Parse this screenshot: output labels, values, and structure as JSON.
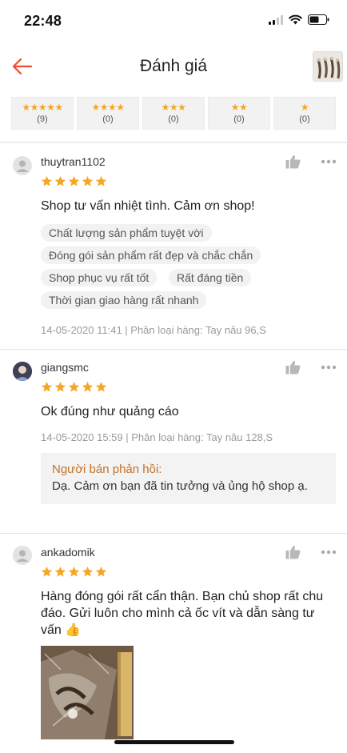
{
  "status_bar": {
    "time": "22:48"
  },
  "header": {
    "title": "Đánh giá"
  },
  "filters": [
    {
      "stars": "★★★★★",
      "count": "(9)"
    },
    {
      "stars": "★★★★",
      "count": "(0)"
    },
    {
      "stars": "★★★",
      "count": "(0)"
    },
    {
      "stars": "★★",
      "count": "(0)"
    },
    {
      "stars": "★",
      "count": "(0)"
    }
  ],
  "reviews": [
    {
      "username": "thuytran1102",
      "rating": 5,
      "comment": "Shop tư vấn nhiệt tình. Cảm ơn shop!",
      "tags": [
        "Chất lượng sản phẩm tuyệt vời",
        "Đóng gói sản phẩm rất đẹp và chắc chắn",
        "Shop phục vụ rất tốt",
        "Rất đáng tiền",
        "Thời gian giao hàng rất nhanh"
      ],
      "meta": "14-05-2020 11:41 | Phân loại hàng: Tay nâu 96,S"
    },
    {
      "username": "giangsmc",
      "rating": 5,
      "comment": "Ok đúng như quảng cáo",
      "meta": "14-05-2020 15:59 | Phân loại hàng: Tay nâu 128,S",
      "seller_reply": {
        "title": "Người bán phản hồi:",
        "text": "Dạ. Cảm ơn bạn đã tin tưởng và ủng hộ shop ạ."
      }
    },
    {
      "username": "ankadomik",
      "rating": 5,
      "comment": "Hàng đóng gói rất cẩn thận. Bạn chủ shop rất chu đáo. Gửi luôn cho mình cả ốc vít và dẫn sàng tư vấn 👍"
    }
  ],
  "colors": {
    "accent": "#ee4d2d",
    "star": "#f5a623",
    "reply_title": "#c2722b"
  }
}
